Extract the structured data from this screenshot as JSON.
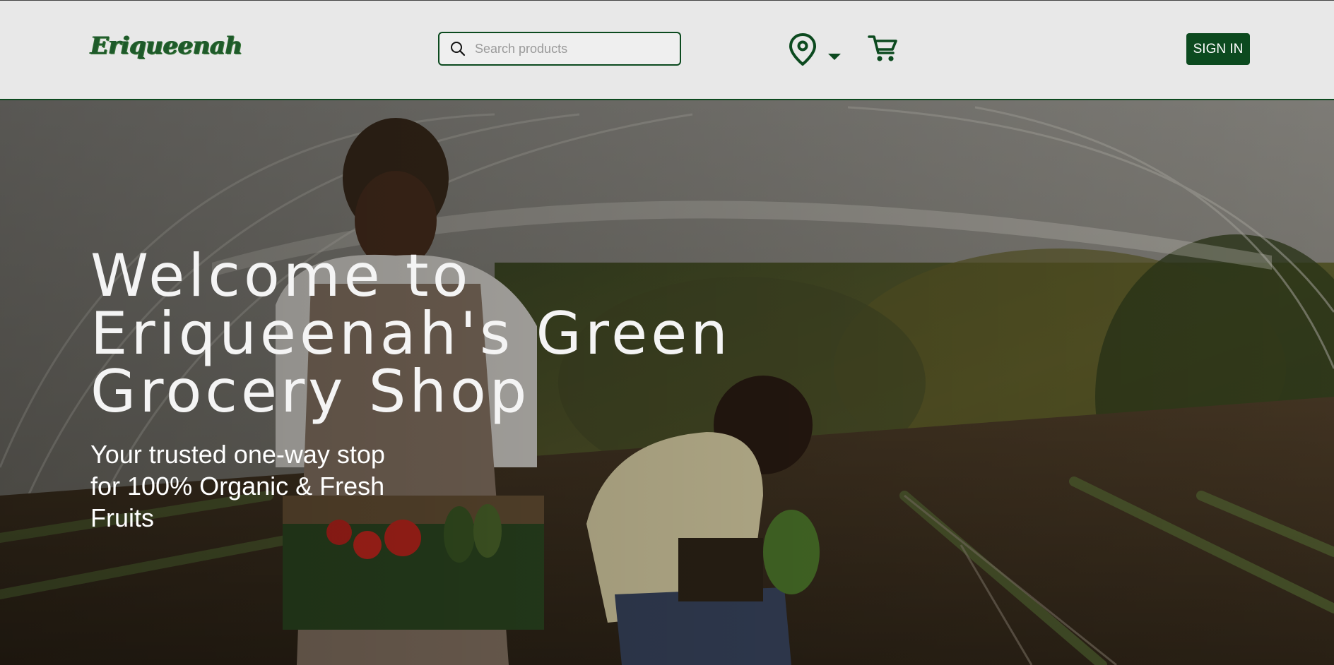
{
  "brand": {
    "logo_text": "Eriqueenah"
  },
  "search": {
    "placeholder": "Search products"
  },
  "header": {
    "signin_label": "SIGN IN"
  },
  "icons": {
    "search": "search-icon",
    "location": "location-pin-icon",
    "dropdown": "caret-down-icon",
    "cart": "cart-icon"
  },
  "hero": {
    "title": "Welcome to Eriqueenah's Green Grocery Shop",
    "subtitle": "Your trusted one-way stop for 100% Organic & Fresh Fruits"
  },
  "colors": {
    "brand_green": "#0c4a1f",
    "header_bg": "#e8e8e8",
    "hero_text": "#ffffff"
  }
}
